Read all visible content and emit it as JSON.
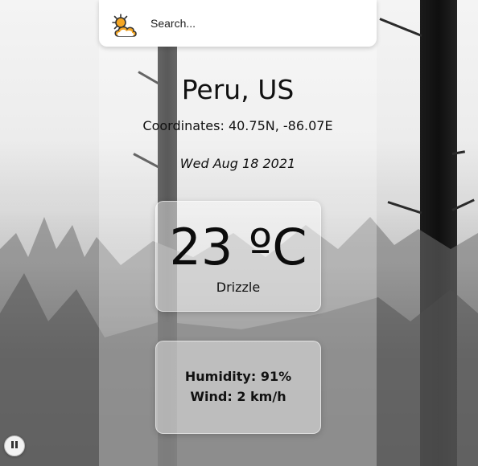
{
  "search": {
    "placeholder": "Search..."
  },
  "weather": {
    "location": "Peru, US",
    "coordinates": "Coordinates: 40.75N, -86.07E",
    "date": "Wed Aug 18 2021",
    "temperature": "23 ºC",
    "condition": "Drizzle",
    "humidity": "Humidity: 91%",
    "wind": "Wind: 2 km/h"
  },
  "icons": {
    "logo": "partly-cloudy-icon",
    "pause": "pause-icon"
  },
  "colors": {
    "sun": "#f5a623",
    "cloud_outline": "#333333"
  }
}
